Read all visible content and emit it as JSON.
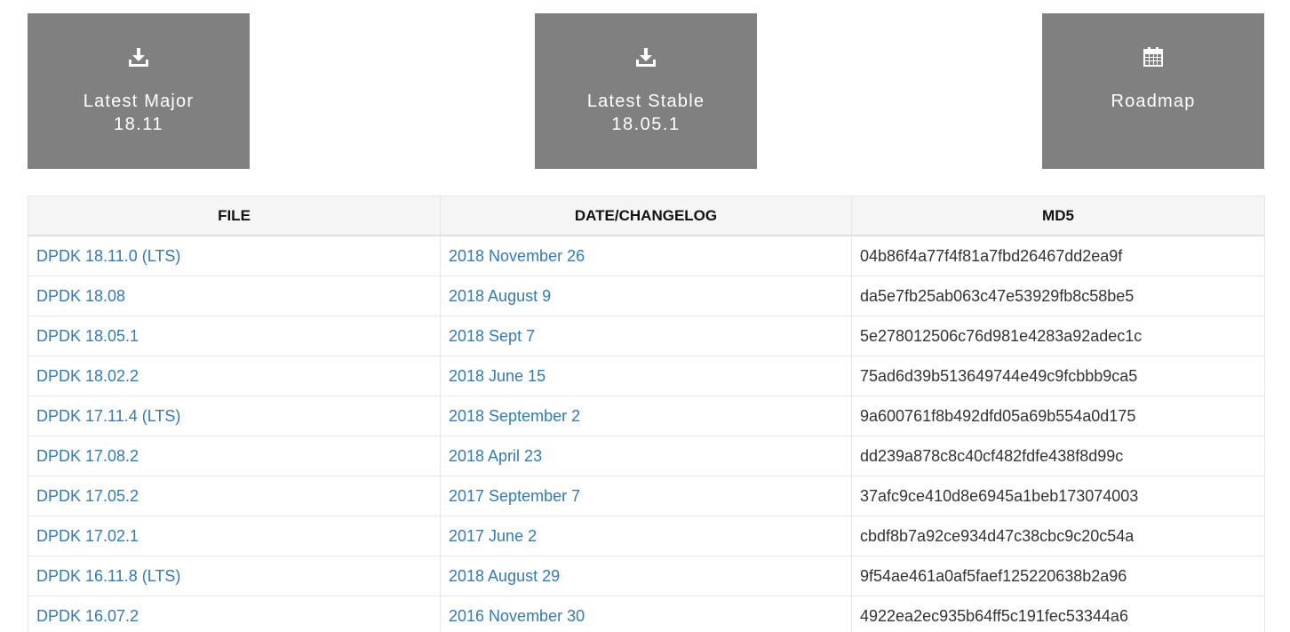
{
  "colors": {
    "tile_bg": "#808080",
    "tile_text": "#ffffff",
    "link": "#337ab7",
    "header_bg": "#f5f5f5",
    "border": "#e6e6e6"
  },
  "tiles": [
    {
      "icon": "download-icon",
      "label": "Latest Major",
      "version": "18.11"
    },
    {
      "icon": "download-icon",
      "label": "Latest Stable",
      "version": "18.05.1"
    },
    {
      "icon": "calendar-icon",
      "label": "Roadmap",
      "version": ""
    }
  ],
  "table": {
    "headers": [
      "FILE",
      "DATE/CHANGELOG",
      "MD5"
    ],
    "rows": [
      {
        "file": "DPDK 18.11.0 (LTS)",
        "date": "2018 November 26",
        "md5": "04b86f4a77f4f81a7fbd26467dd2ea9f"
      },
      {
        "file": "DPDK 18.08",
        "date": "2018 August 9",
        "md5": "da5e7fb25ab063c47e53929fb8c58be5"
      },
      {
        "file": "DPDK 18.05.1",
        "date": "2018 Sept 7",
        "md5": "5e278012506c76d981e4283a92adec1c"
      },
      {
        "file": "DPDK 18.02.2",
        "date": "2018 June 15",
        "md5": "75ad6d39b513649744e49c9fcbbb9ca5"
      },
      {
        "file": "DPDK 17.11.4 (LTS)",
        "date": "2018 September 2",
        "md5": "9a600761f8b492dfd05a69b554a0d175"
      },
      {
        "file": "DPDK 17.08.2",
        "date": "2018 April 23",
        "md5": "dd239a878c8c40cf482fdfe438f8d99c"
      },
      {
        "file": "DPDK 17.05.2",
        "date": "2017 September 7",
        "md5": "37afc9ce410d8e6945a1beb173074003"
      },
      {
        "file": "DPDK 17.02.1",
        "date": "2017 June 2",
        "md5": "cbdf8b7a92ce934d47c38cbc9c20c54a"
      },
      {
        "file": "DPDK 16.11.8 (LTS)",
        "date": "2018 August 29",
        "md5": "9f54ae461a0af5faef125220638b2a96"
      },
      {
        "file": "DPDK 16.07.2",
        "date": "2016 November 30",
        "md5": "4922ea2ec935b64ff5c191fec53344a6"
      }
    ]
  }
}
